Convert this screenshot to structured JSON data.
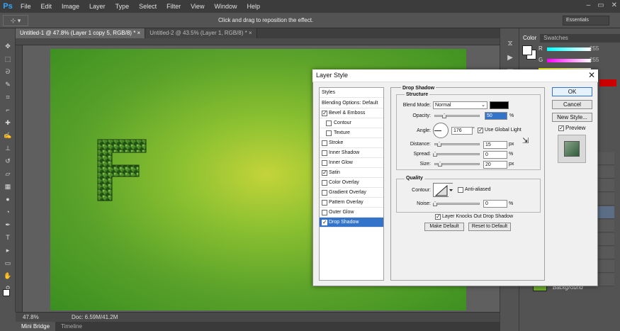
{
  "menubar": {
    "logo": "Ps",
    "items": [
      "File",
      "Edit",
      "Image",
      "Layer",
      "Type",
      "Select",
      "Filter",
      "View",
      "Window",
      "Help"
    ],
    "window_controls": [
      "–",
      "▭",
      "✕"
    ]
  },
  "options": {
    "hint": "Click and drag to reposition the effect.",
    "workspace": "Essentials",
    "tool_preset": "⊹ ▾"
  },
  "tabs": [
    {
      "label": "Untitled-1 @ 47.8% (Layer 1 copy 5, RGB/8) *",
      "close": "×"
    },
    {
      "label": "Untitled-2 @ 43.5% (Layer 1, RGB/8) *",
      "close": "×"
    }
  ],
  "status": {
    "zoom": "47.8%",
    "doc": "Doc: 6.59M/41.2M"
  },
  "bottom_tabs": [
    "Mini Bridge",
    "Timeline"
  ],
  "right_panel": {
    "tabs": [
      "Color",
      "Swatches"
    ],
    "sliders": [
      {
        "label": "R",
        "value": "255",
        "color": "#ff4b4b"
      },
      {
        "label": "G",
        "value": "255",
        "color": "#41d941"
      }
    ],
    "background_layer": "Background"
  },
  "dialog": {
    "title": "Layer Style",
    "close": "✕",
    "styles_header": "Styles",
    "blending": "Blending Options: Default",
    "items": [
      {
        "label": "Bevel & Emboss",
        "checked": true
      },
      {
        "label": "Contour",
        "checked": false
      },
      {
        "label": "Texture",
        "checked": false
      },
      {
        "label": "Stroke",
        "checked": false
      },
      {
        "label": "Inner Shadow",
        "checked": false
      },
      {
        "label": "Inner Glow",
        "checked": false
      },
      {
        "label": "Satin",
        "checked": true
      },
      {
        "label": "Color Overlay",
        "checked": false
      },
      {
        "label": "Gradient Overlay",
        "checked": false
      },
      {
        "label": "Pattern Overlay",
        "checked": false
      },
      {
        "label": "Outer Glow",
        "checked": false
      },
      {
        "label": "Drop Shadow",
        "checked": true
      }
    ],
    "section_title": "Drop Shadow",
    "structure_title": "Structure",
    "blend_mode_label": "Blend Mode:",
    "blend_mode": "Normal",
    "shadow_color": "#000000",
    "opacity_label": "Opacity:",
    "opacity": "50",
    "angle_label": "Angle:",
    "angle": "176",
    "angle_unit": "°",
    "use_global_light": "Use Global Light",
    "distance_label": "Distance:",
    "distance": "15",
    "spread_label": "Spread:",
    "spread": "0",
    "size_label": "Size:",
    "size": "20",
    "quality_title": "Quality",
    "contour_label": "Contour:",
    "anti_aliased": "Anti-aliased",
    "noise_label": "Noise:",
    "noise": "0",
    "knockout": "Layer Knocks Out Drop Shadow",
    "make_default": "Make Default",
    "reset_default": "Reset to Default",
    "ok": "OK",
    "cancel": "Cancel",
    "new_style": "New Style...",
    "preview": "Preview",
    "unit_percent": "%",
    "unit_px": "px",
    "check_mark": "✓"
  }
}
